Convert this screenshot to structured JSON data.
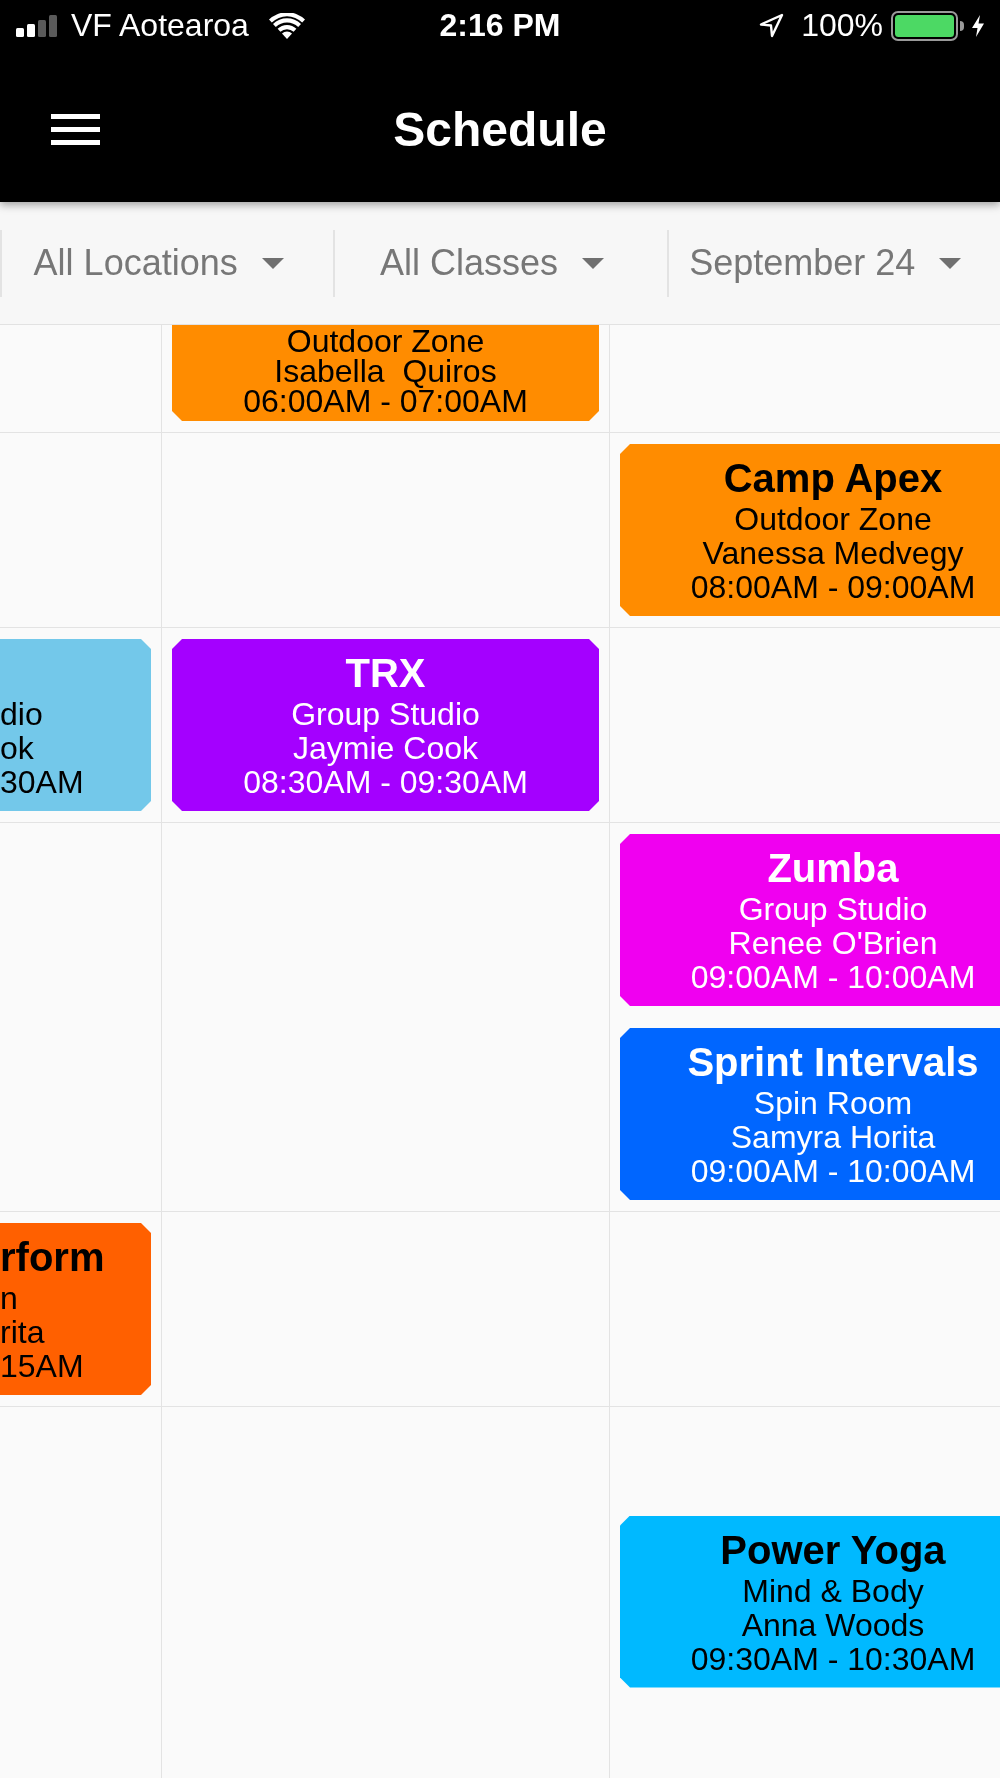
{
  "status_bar": {
    "carrier": "VF Aotearoa",
    "time": "2:16 PM",
    "battery": "100%"
  },
  "header": {
    "title": "Schedule"
  },
  "filters": [
    {
      "label": "All Locations"
    },
    {
      "label": "All Classes"
    },
    {
      "label": "September 24"
    }
  ],
  "schedule": {
    "rows": [
      {
        "column_2": [
          {
            "location": "Outdoor Zone",
            "instructor": "Isabella  Quiros",
            "time": "06:00AM - 07:00AM",
            "color": "#ff8c00"
          }
        ]
      },
      {
        "column_3": [
          {
            "title": "Camp Apex",
            "location": "Outdoor Zone",
            "instructor": "Vanessa Medvegy",
            "time": "08:00AM - 09:00AM",
            "color": "#ff8c00"
          }
        ]
      },
      {
        "column_1": [
          {
            "location": "dio",
            "instructor": "ok",
            "time": "30AM",
            "color": "#73c8ea"
          }
        ],
        "column_2": [
          {
            "title": "TRX",
            "location": "Group Studio",
            "instructor": "Jaymie Cook",
            "time": "08:30AM - 09:30AM",
            "color": "#a400ff"
          }
        ]
      },
      {
        "column_3": [
          {
            "title": "Zumba",
            "location": "Group Studio",
            "instructor": "Renee O'Brien",
            "time": "09:00AM - 10:00AM",
            "color": "#f000f0"
          },
          {
            "title": "Sprint Intervals",
            "location": "Spin Room",
            "instructor": "Samyra Horita",
            "time": "09:00AM - 10:00AM",
            "color": "#0066ff"
          }
        ]
      },
      {
        "column_1": [
          {
            "title": "rform",
            "location": "n",
            "instructor": "rita",
            "time": "15AM",
            "color": "#ff6000"
          }
        ]
      },
      {
        "column_3": [
          {
            "title": "Power Yoga",
            "location": "Mind & Body",
            "instructor": "Anna Woods",
            "time": "09:30AM - 10:30AM",
            "color": "#00b9ff"
          }
        ]
      }
    ]
  }
}
